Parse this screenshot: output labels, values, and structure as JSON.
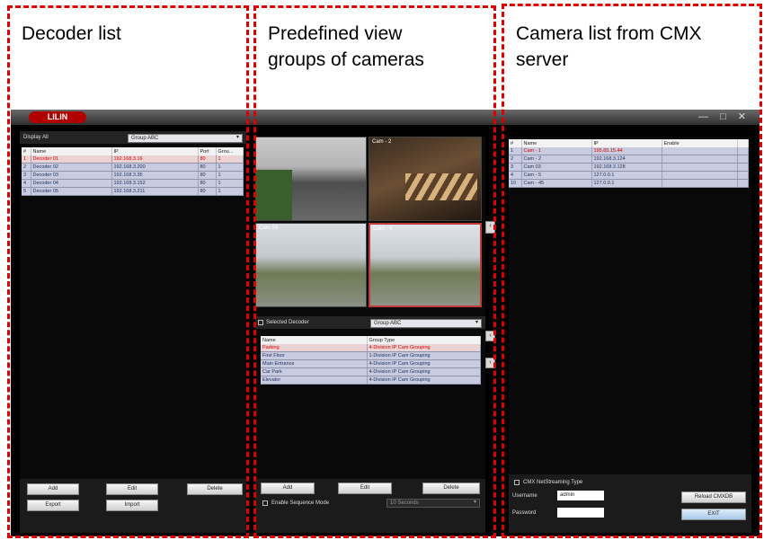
{
  "annotations": {
    "decoder": "Decoder list",
    "views_line1": "Predefined view",
    "views_line2": "groups of cameras",
    "cameras_line1": "Camera list from CMX",
    "cameras_line2": "server"
  },
  "app": {
    "logo": "LILIN",
    "window_controls": "— □ ✕"
  },
  "decoder_panel": {
    "display_label": "Display All",
    "group_select": "Group ABC",
    "columns": [
      "#",
      "Name",
      "IP",
      "Port",
      "Grou..."
    ],
    "rows": [
      [
        "1",
        "Decoder 01",
        "192.168.3.16",
        "80",
        "1"
      ],
      [
        "2",
        "Decoder 02",
        "192.168.3.200",
        "80",
        "1"
      ],
      [
        "3",
        "Decoder 03",
        "192.168.3.35",
        "80",
        "1"
      ],
      [
        "4",
        "Decoder 04",
        "192.168.3.152",
        "80",
        "1"
      ],
      [
        "5",
        "Decoder 05",
        "192.168.3.211",
        "80",
        "1"
      ]
    ],
    "buttons": {
      "add": "Add",
      "edit": "Edit",
      "delete": "Delete",
      "export": "Export",
      "import": "Import"
    }
  },
  "view_panel": {
    "cameras": [
      "",
      "Cam - 2",
      "Cam 03",
      "Cam - 4"
    ],
    "selected_decoder_label": "Selected Decoder",
    "group_select": "Group ABC",
    "columns": [
      "Name",
      "Group Type"
    ],
    "rows": [
      [
        "Parking",
        "4-Division IP Cam Grouping"
      ],
      [
        "First Floor",
        "1-Division IP Cam Grouping"
      ],
      [
        "Main Entrance",
        "4-Division IP Cam Grouping"
      ],
      [
        "Car Park",
        "4-Division IP Cam Grouping"
      ],
      [
        "Elevator",
        "4-Division IP Cam Grouping"
      ]
    ],
    "buttons": {
      "add": "Add",
      "edit": "Edit",
      "delete": "Delete"
    },
    "sequence_label": "Enable Sequence Mode",
    "seconds_select": "10 Seconds"
  },
  "camera_panel": {
    "columns": [
      "#",
      "Name",
      "IP",
      "Enable"
    ],
    "rows": [
      [
        "1",
        "Cam - 1",
        "195.65.15.44",
        ""
      ],
      [
        "2",
        "Cam - 2",
        "192.168.3.124",
        ""
      ],
      [
        "3",
        "Cam 03",
        "192.168.3.128",
        ""
      ],
      [
        "4",
        "Cam - 5",
        "127.0.0.1",
        ""
      ],
      [
        "10",
        "Cam - 45",
        "127.0.0.1",
        ""
      ]
    ],
    "streaming_label": "CMX NetStreaming Type",
    "username_label": "Username",
    "username_value": "admin",
    "password_label": "Password",
    "password_value": "",
    "reload_button": "Reload CMXDB",
    "exit_button": "EXIT"
  }
}
